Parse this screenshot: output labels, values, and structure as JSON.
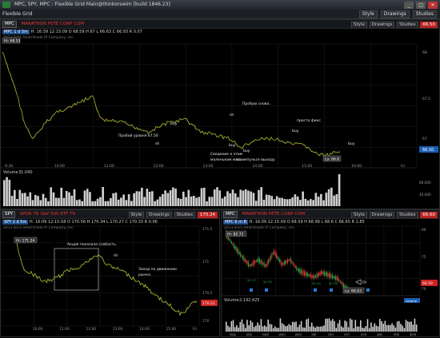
{
  "window": {
    "title": "MPC, SPY, MPC : Flexible Grid Main@thinkorswim [build 1846.23]",
    "buttons": [
      "_",
      "□",
      "✕"
    ]
  },
  "toolbar": {
    "grid_label": "Flexible Grid",
    "style": "Style",
    "drawings": "Drawings",
    "studies": "Studies"
  },
  "top": {
    "symbol": "MPC",
    "period": "MPC 1 d 5m",
    "red": "MARATHON PETE CORP COM",
    "quote": "H: 16:39 12:15:09  O 68.59  H 67  L 66.63  C 66.93  R 0.07",
    "subtitle": "2013 8/15 Ameritrade IP Company, Inc.",
    "hi_tag": "Hi: 68.53",
    "lo_tag": "Lo: 66.6",
    "price_tag": "66.50",
    "price_ticks": [
      "68",
      "67.5",
      "67"
    ],
    "time_ticks": [
      "9:30",
      "10:00",
      "11:00",
      "12:00",
      "13:00",
      "14:00",
      "15:00",
      "16:00",
      "Fri"
    ],
    "volume_label": "Volume",
    "volume_value": "31,040",
    "volume_ticks": [
      "80,000",
      "40,000"
    ],
    "annotations": [
      "buy",
      "buy",
      "sh",
      "Пробую снова..",
      "sh",
      "Пробой уровня 67,50",
      "buy",
      "просто фикс.",
      "buy",
      "Сведение к этим",
      "маленьким масо ..",
      "buy",
      "на импульсе выходу",
      "buy"
    ]
  },
  "left": {
    "symbol": "SPY",
    "period": "SPY 2 d 5m",
    "red": "SPDR TR S&P 500 ETF TR",
    "quote": "H: 16:09 12:15:58  O 170.56  H 170.34  L 170.27  C 170.33  R 0.06",
    "subtitle": "2013 8/15 Ameritrade IP Company, Inc.",
    "hi_tag": "Hi: 171.24",
    "price_tag": "170.24",
    "price_tag_value": "170.21",
    "price_ticks": [
      "171.5",
      "171",
      "170.5",
      "170"
    ],
    "time_ticks": [
      "10:00",
      "11:00",
      "12:00",
      "13:00",
      "14:00",
      "15:00",
      "Fri"
    ],
    "annotations": [
      "Акция показала слабость.",
      "sh",
      "Заход по движению",
      "рынка."
    ]
  },
  "right": {
    "symbol": "MPC",
    "period": "MPC 6 m B",
    "red": "MARATHON PETE CORP COM",
    "quote": "H: 16:09 12:15:09  O 68.59  H 68.99  L 68.6  C 66.65  R 1.85",
    "subtitle": "2013 8/15 Ameritrade IP Company, Inc.",
    "hi_tag": "Hi: 82.72",
    "lo_tag": "Lo: 66.63",
    "price_tag": "66.60",
    "price_tag_value": "66.59",
    "price_ticks": [
      "80",
      "75",
      "70"
    ],
    "time_ticks": [
      "мар",
      "апр",
      "май",
      "июн",
      "июл",
      "авг",
      "сен",
      "окт",
      "ноя",
      "дек",
      "янв",
      "фев"
    ],
    "volume_label": "Volume",
    "volume_value": "2,192,425",
    "volume_badge": "volume",
    "markers": [
      "$0.11",
      "$0.35",
      "$1.00",
      "$0.30"
    ]
  }
}
